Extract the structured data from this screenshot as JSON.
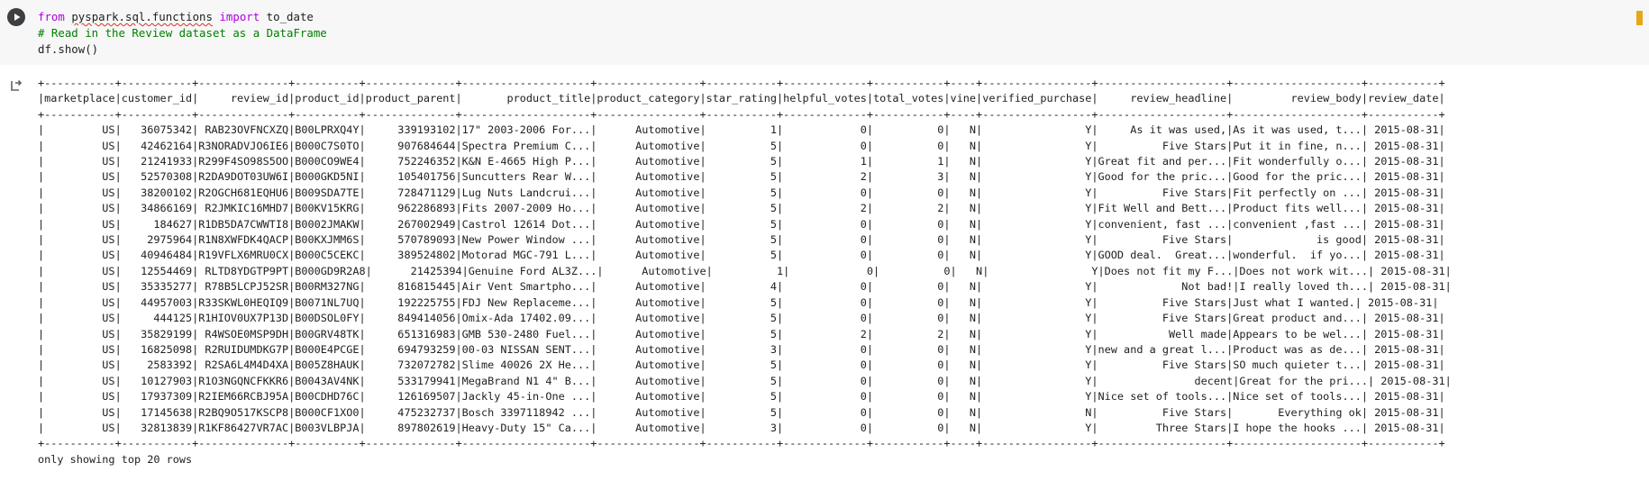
{
  "cell": {
    "code_lines": [
      {
        "kw1": "from",
        "module": "pyspark.sql.functions",
        "kw2": "import",
        "name": "to_date"
      },
      "# Read in the Review dataset as a DataFrame",
      "df.show()"
    ]
  },
  "table": {
    "border": "+-----------+-----------+--------------+----------+--------------+--------------------+----------------+-----------+-------------+-----------+----+-----------------+--------------------+--------------------+-----------+",
    "header": "|marketplace|customer_id|     review_id|product_id|product_parent|       product_title|product_category|star_rating|helpful_votes|total_votes|vine|verified_purchase|     review_headline|         review_body|review_date|",
    "rows": [
      "|         US|   36075342| RAB23OVFNCXZQ|B00LPRXQ4Y|     339193102|17\" 2003-2006 For...|      Automotive|          1|            0|          0|   N|                Y|     As it was used,|As it was used, t...| 2015-08-31|",
      "|         US|   42462164|R3NORADVJO6IE6|B000C7S0TO|     907684644|Spectra Premium C...|      Automotive|          5|            0|          0|   N|                Y|          Five Stars|Put it in fine, n...| 2015-08-31|",
      "|         US|   21241933|R299F4SO98S5OO|B000CO9WE4|     752246352|K&N E-4665 High P...|      Automotive|          5|            1|          1|   N|                Y|Great fit and per...|Fit wonderfully o...| 2015-08-31|",
      "|         US|   52570308|R2DA9DOT03UW6I|B000GKD5NI|     105401756|Suncutters Rear W...|      Automotive|          5|            2|          3|   N|                Y|Good for the pric...|Good for the pric...| 2015-08-31|",
      "|         US|   38200102|R2OGCH681EQHU6|B009SDA7TE|     728471129|Lug Nuts Landcrui...|      Automotive|          5|            0|          0|   N|                Y|          Five Stars|Fit perfectly on ...| 2015-08-31|",
      "|         US|   34866169| R2JMKIC16MHD7|B00KV15KRG|     962286893|Fits 2007-2009 Ho...|      Automotive|          5|            2|          2|   N|                Y|Fit Well and Bett...|Product fits well...| 2015-08-31|",
      "|         US|     184627|R1DB5DA7CWWTI8|B0002JMAKW|     267002949|Castrol 12614 Dot...|      Automotive|          5|            0|          0|   N|                Y|convenient, fast ...|convenient ,fast ...| 2015-08-31|",
      "|         US|    2975964|R1N8XWFDK4QACP|B00KXJMM6S|     570789093|New Power Window ...|      Automotive|          5|            0|          0|   N|                Y|          Five Stars|             is good| 2015-08-31|",
      "|         US|   40946484|R19VFLX6MRU0CX|B000C5CEKC|     389524802|Motorad MGC-791 L...|      Automotive|          5|            0|          0|   N|                Y|GOOD deal.  Great...|wonderful.  if yo...| 2015-08-31|",
      "|         US|   12554469| RLTD8YDGTP9PT|B000GD9R2A8|      21425394|Genuine Ford AL3Z...|      Automotive|          1|            0|          0|   N|                Y|Does not fit my F...|Does not work wit...| 2015-08-31|",
      "|         US|   35335277| R78B5LCPJ52SR|B00RM327NG|     816815445|Air Vent Smartpho...|      Automotive|          4|            0|          0|   N|                Y|             Not bad!|I really loved th...| 2015-08-31|",
      "|         US|   44957003|R33SKWL0HEQIQ9|B0071NL7UQ|     192225755|FDJ New Replaceme...|      Automotive|          5|            0|          0|   N|                Y|          Five Stars|Just what I wanted.| 2015-08-31|",
      "|         US|     444125|R1HIOV0UX7P13D|B00DSOL0FY|     849414056|Omix-Ada 17402.09...|      Automotive|          5|            0|          0|   N|                Y|          Five Stars|Great product and...| 2015-08-31|",
      "|         US|   35829199| R4WSOE0MSP9DH|B00GRV48TK|     651316983|GMB 530-2480 Fuel...|      Automotive|          5|            2|          2|   N|                Y|           Well made|Appears to be wel...| 2015-08-31|",
      "|         US|   16825098| R2RUIDUMDKG7P|B000E4PCGE|     694793259|00-03 NISSAN SENT...|      Automotive|          3|            0|          0|   N|                Y|new and a great l...|Product was as de...| 2015-08-31|",
      "|         US|    2583392| R2SA6L4M4D4XA|B005Z8HAUK|     732072782|Slime 40026 2X He...|      Automotive|          5|            0|          0|   N|                Y|          Five Stars|SO much quieter t...| 2015-08-31|",
      "|         US|   10127903|R1O3NGQNCFKKR6|B0043AV4NK|     533179941|MegaBrand N1 4\" B...|      Automotive|          5|            0|          0|   N|                Y|               decent|Great for the pri...| 2015-08-31|",
      "|         US|   17937309|R2IEM66RCBJ95A|B00CDHD76C|     126169507|Jackly 45-in-One ...|      Automotive|          5|            0|          0|   N|                Y|Nice set of tools...|Nice set of tools...| 2015-08-31|",
      "|         US|   17145638|R2BQ9O517KSCP8|B000CF1XO0|     475232737|Bosch 3397118942 ...|      Automotive|          5|            0|          0|   N|                N|          Five Stars|       Everything ok| 2015-08-31|",
      "|         US|   32813839|R1KF86427VR7AC|B003VLBPJA|     897802619|Heavy-Duty 15\" Ca...|      Automotive|          3|            0|          0|   N|                Y|         Three Stars|I hope the hooks ...| 2015-08-31|"
    ],
    "footer_note": "only showing top 20 rows"
  },
  "icons": {
    "run_button": "play-circle-icon",
    "output_indicator": "output-arrow-icon"
  },
  "colors": {
    "keyword": "#af00db",
    "comment": "#008000",
    "cell_background": "#f7f7f7",
    "scroll_marker": "#e6a817"
  }
}
